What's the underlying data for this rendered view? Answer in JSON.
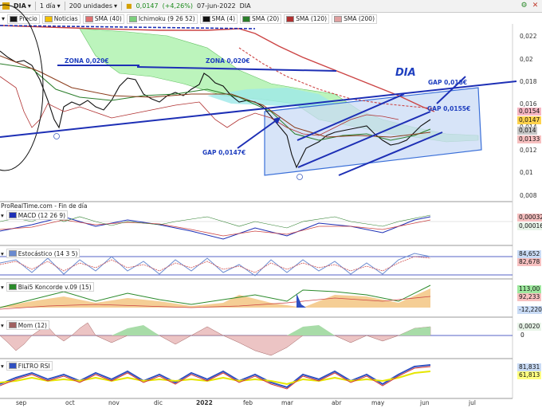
{
  "toolbar": {
    "ticker": "DIA",
    "interval": "1 día",
    "units": "200 unidades",
    "price": "0,0147",
    "change": "(+4,26%)",
    "date": "07-jun-2022",
    "name": "DIA"
  },
  "legend": {
    "items": [
      {
        "label": "Precio",
        "color": "#1a1a1a"
      },
      {
        "label": "Noticias",
        "color": "#f3c000"
      },
      {
        "label": "SMA (40)",
        "color": "#c44"
      },
      {
        "label": "Ichimoku (9 26 52)",
        "color": "#4a4"
      },
      {
        "label": "SMA (4)",
        "color": "#111"
      },
      {
        "label": "SMA (20)",
        "color": "#2a7d2a"
      },
      {
        "label": "SMA (120)",
        "color": "#b03030"
      },
      {
        "label": "SMA (200)",
        "color": "#e0a0a0"
      }
    ]
  },
  "price_axis": [
    "0,022",
    "0,02",
    "0,018",
    "0,016",
    "0,014",
    "0,012",
    "0,01",
    "0,008"
  ],
  "price_tags": [
    {
      "text": "0,0154",
      "color": "#f7b6c2"
    },
    {
      "text": "0,0147",
      "color": "#ffd34d"
    },
    {
      "text": "0,014",
      "color": "#c7c7c7"
    },
    {
      "text": "0,0133",
      "color": "#f7c0c0"
    }
  ],
  "annotations": {
    "zona1": "ZONA 0,020€",
    "zona2": "ZONA 0,020€",
    "dia": "DIA",
    "gap1": "GAP 0,018€",
    "gap2": "GAP 0,0155€",
    "gap3": "GAP 0,0147€"
  },
  "source": "ProRealTime.com - Fin de día",
  "panels": {
    "macd": {
      "label": "MACD (12 26 9)",
      "tags": [
        "0,00032",
        "0,00016"
      ]
    },
    "stoch": {
      "label": "Estocástico (14 3 5)",
      "tags": [
        "84,652",
        "82,678"
      ]
    },
    "blai": {
      "label": "Blai5 Koncorde v.09 (15)",
      "tags": [
        "113,00",
        "92,233",
        "-12,220"
      ]
    },
    "mom": {
      "label": "Mom (12)",
      "tags": [
        "0,0020",
        "0"
      ]
    },
    "rsi": {
      "label": "FILTRO RSI",
      "tags": [
        "81,831",
        "61,813"
      ]
    }
  },
  "months": [
    "sep",
    "oct",
    "nov",
    "dic",
    "2022",
    "feb",
    "mar",
    "abr",
    "may",
    "jun",
    "jul"
  ],
  "icons": {
    "dropdown": "chevron-down-icon",
    "menu": "dropdown-menu-icon",
    "settings": "settings-icon",
    "close": "close-icon"
  }
}
